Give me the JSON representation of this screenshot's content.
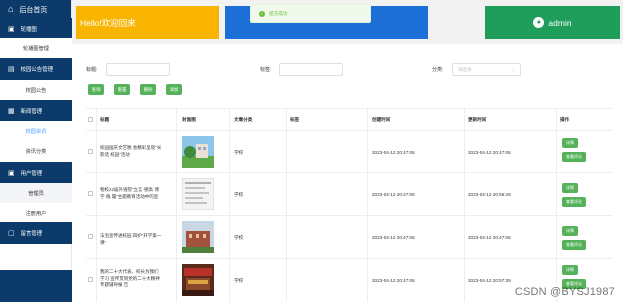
{
  "sidebar": {
    "brand": "后台首页",
    "home_icon": "home-icon",
    "groups": [
      {
        "label": "轮播图",
        "icon": "image-icon"
      },
      {
        "label": "校园公告管理",
        "icon": "notice-icon"
      },
      {
        "label": "新闻管理",
        "icon": "news-icon"
      },
      {
        "label": "用户管理",
        "icon": "user-icon"
      },
      {
        "label": "留言管理",
        "icon": "message-icon"
      }
    ],
    "items": [
      "轮播图管理",
      "校园公告",
      "校园资讯",
      "资讯分类",
      "管理员",
      "注册用户"
    ],
    "active_item": "校园资讯"
  },
  "header": {
    "welcome": "Hello!欢迎回来",
    "toast": "提交成功",
    "user": "admin"
  },
  "search": {
    "title_label": "标题:",
    "tag_label": "标签:",
    "category_label": "分类:",
    "category_placeholder": "请选择"
  },
  "buttons": {
    "search": "查询",
    "reset": "重置",
    "delete": "删除",
    "add": "添加"
  },
  "table": {
    "columns": [
      "标题",
      "封面图",
      "文章分类",
      "标签",
      "创建时间",
      "更新时间",
      "操作"
    ],
    "rows": [
      {
        "title": "校园国庆文艺晚 会精彩呈现“光影话 校园”活动",
        "category": "学校",
        "tag": "",
        "created": "2023-04-12 20:47:06",
        "updated": "2023-04-12 20:47:06"
      },
      {
        "title": "物校22届外语院“立言·德高·博学·践 履”主题教育活动中的宣",
        "category": "学校",
        "tag": "",
        "created": "2023-04-12 20:47:06",
        "updated": "2023-04-12 20:56:29"
      },
      {
        "title": "法治宣传进校园 四护“开学第一课”",
        "category": "学校",
        "tag": "",
        "created": "2023-04-12 20:47:06",
        "updated": "2023-04-12 20:47:06"
      },
      {
        "title": "我的二十大代表、校长为我们学习 宣传贯彻党的二十大精神专题辅导报 告",
        "category": "学校",
        "tag": "",
        "created": "2023-04-12 20:47:06",
        "updated": "2023-04-12 20:57:39"
      }
    ],
    "ops": {
      "detail": "详情",
      "comments": "查看评论"
    }
  },
  "watermark": "CSDN @BYSJ1987",
  "colors": {
    "sidebar": "#0b3a6b",
    "yellow": "#f8b400",
    "blue": "#1d6fd8",
    "green": "#1e9e5a",
    "button": "#56b25a",
    "toast": "#f0f9eb"
  }
}
